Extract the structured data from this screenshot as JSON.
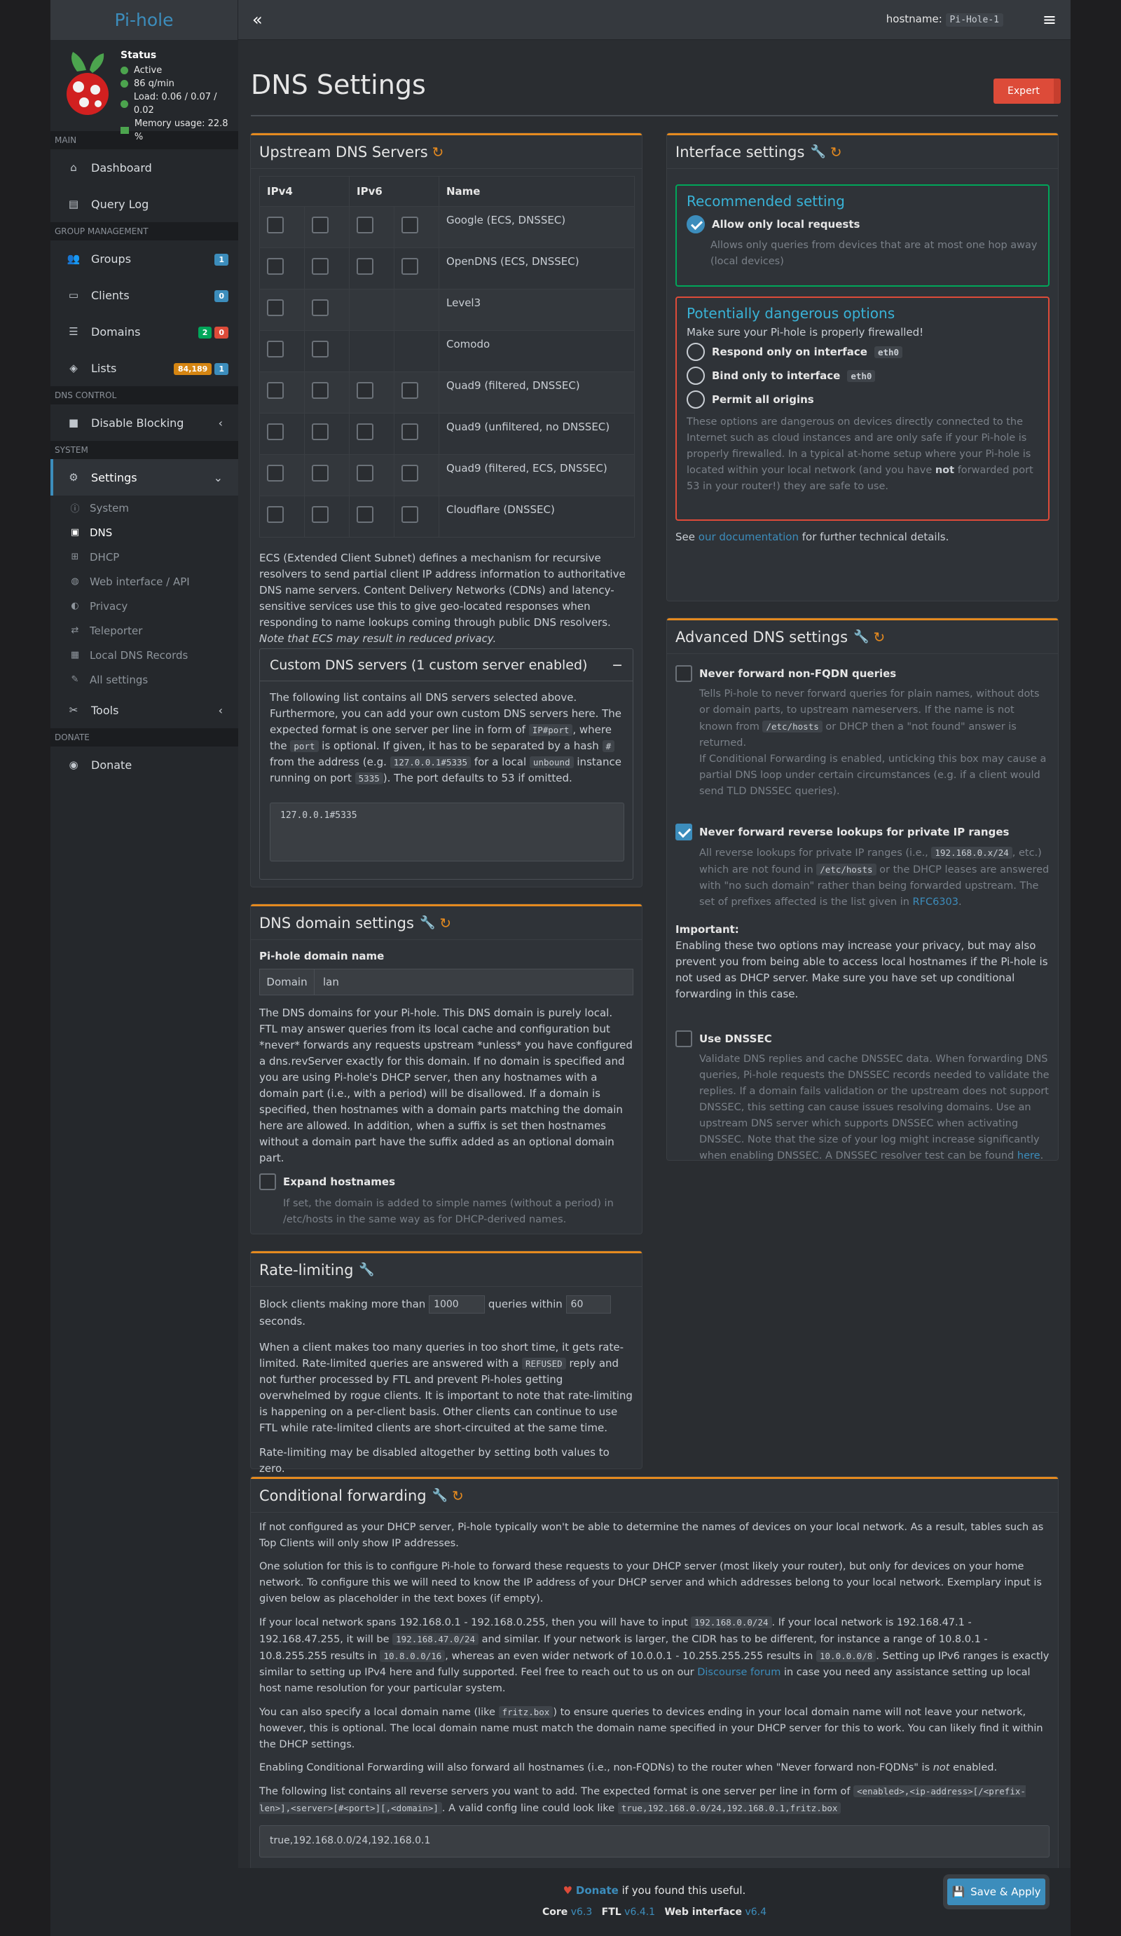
{
  "app": {
    "brand_pi": "Pi",
    "brand_rest": "-hole",
    "hostname_label": "hostname:",
    "hostname": "Pi-Hole-1",
    "collapse_icon": "«",
    "menu_icon": "≡"
  },
  "status": {
    "title": "Status",
    "active": "Active",
    "rate": "86 q/min",
    "load": "Load: 0.06 / 0.07 / 0.02",
    "memory": "Memory usage: 22.8 %"
  },
  "sidebar": {
    "sections": {
      "main": "MAIN",
      "group": "GROUP MANAGEMENT",
      "dnsctl": "DNS CONTROL",
      "system": "SYSTEM",
      "donate": "DONATE"
    },
    "dashboard": "Dashboard",
    "querylog": "Query Log",
    "groups": "Groups",
    "groups_badge": "1",
    "clients": "Clients",
    "clients_badge": "0",
    "domains": "Domains",
    "domains_b1": "2",
    "domains_b2": "0",
    "lists": "Lists",
    "lists_b1": "84,189",
    "lists_b2": "1",
    "disable": "Disable Blocking",
    "settings": "Settings",
    "sub": {
      "system": "System",
      "dns": "DNS",
      "dhcp": "DHCP",
      "web": "Web interface / API",
      "privacy": "Privacy",
      "teleporter": "Teleporter",
      "localdns": "Local DNS Records",
      "all": "All settings"
    },
    "tools": "Tools",
    "donate": "Donate"
  },
  "page": {
    "title": "DNS Settings",
    "expert": "Expert"
  },
  "upstream": {
    "title": "Upstream DNS Servers",
    "h_ipv4": "IPv4",
    "h_ipv6": "IPv6",
    "h_name": "Name",
    "rows": [
      {
        "name": "Google (ECS, DNSSEC)"
      },
      {
        "name": "OpenDNS (ECS, DNSSEC)"
      },
      {
        "name": "Level3"
      },
      {
        "name": "Comodo"
      },
      {
        "name": "Quad9 (filtered, DNSSEC)"
      },
      {
        "name": "Quad9 (unfiltered, no DNSSEC)"
      },
      {
        "name": "Quad9 (filtered, ECS, DNSSEC)"
      },
      {
        "name": "Cloudflare (DNSSEC)"
      }
    ],
    "ecs_text": "ECS (Extended Client Subnet) defines a mechanism for recursive resolvers to send partial client IP address information to authoritative DNS name servers. Content Delivery Networks (CDNs) and latency-sensitive services use this to give geo-located responses when responding to name lookups coming through public DNS resolvers.",
    "ecs_note": "Note that ECS may result in reduced privacy.",
    "custom_title": "Custom DNS servers (1 custom server enabled)",
    "custom_minus": "−",
    "custom_p1": "The following list contains all DNS servers selected above. Furthermore, you can add your own custom DNS servers here. The expected format is one server per line in form of",
    "code_ipport": "IP#port",
    "custom_p2": ", where the",
    "code_port": "port",
    "custom_p3": "is optional. If given, it has to be separated by a hash",
    "code_hash": "#",
    "custom_p4": "from the address (e.g.",
    "code_ex": "127.0.0.1#5335",
    "custom_p5": "for a local",
    "code_unbound": "unbound",
    "custom_p6": "instance running on port",
    "code_5335": "5335",
    "custom_p7": "). The port defaults to 53 if omitted.",
    "custom_value": "127.0.0.1#5335"
  },
  "domain": {
    "title": "DNS domain settings",
    "label": "Pi-hole domain name",
    "addon": "Domain",
    "value": "lan",
    "desc": "The DNS domains for your Pi-hole. This DNS domain is purely local. FTL may answer queries from its local cache and configuration but *never* forwards any requests upstream *unless* you have configured a dns.revServer exactly for this domain. If no domain is specified and you are using Pi-hole's DHCP server, then any hostnames with a domain part (i.e., with a period) will be disallowed. If a domain is specified, then hostnames with a domain parts matching the domain here are allowed. In addition, when a suffix is set then hostnames without a domain part have the suffix added as an optional domain part.",
    "expand": "Expand hostnames",
    "expand_hint": "If set, the domain is added to simple names (without a period) in /etc/hosts in the same way as for DHCP-derived names."
  },
  "rate": {
    "title": "Rate-limiting",
    "p1": "Block clients making more than",
    "count": "1000",
    "p2": "queries within",
    "secs": "60",
    "p3": "seconds.",
    "desc1a": "When a client makes too many queries in too short time, it gets rate-limited. Rate-limited queries are answered with a",
    "refused": "REFUSED",
    "desc1b": "reply and not further processed by FTL and prevent Pi-holes getting overwhelmed by rogue clients. It is important to note that rate-limiting is happening on a per-client basis. Other clients can continue to use FTL while rate-limited clients are short-circuited at the same time.",
    "desc2": "Rate-limiting may be disabled altogether by setting both values to zero."
  },
  "iface": {
    "title": "Interface settings",
    "rec_title": "Recommended setting",
    "local": "Allow only local requests",
    "local_hint": "Allows only queries from devices that are at most one hop away (local devices)",
    "danger_title": "Potentially dangerous options",
    "danger_sub": "Make sure your Pi-hole is properly firewalled!",
    "only_iface": "Respond only on interface",
    "eth0": "eth0",
    "bind": "Bind only to interface",
    "all": "Permit all origins",
    "danger_hint_a": "These options are dangerous on devices directly connected to the Internet such as cloud instances and are only safe if your Pi-hole is properly firewalled. In a typical at-home setup where your Pi-hole is located within your local network (and you have",
    "danger_not": "not",
    "danger_hint_b": "forwarded port 53 in your router!) they are safe to use.",
    "see": "See",
    "doc": "our documentation",
    "see2": "for further technical details."
  },
  "adv": {
    "title": "Advanced DNS settings",
    "fqdn": "Never forward non-FQDN queries",
    "fqdn_h1": "Tells Pi-hole to never forward queries for plain names, without dots or domain parts, to upstream nameservers. If the name is not known from",
    "etchosts": "/etc/hosts",
    "fqdn_h2": "or DHCP then a \"not found\" answer is returned.",
    "fqdn_h3": "If Conditional Forwarding is enabled, unticking this box may cause a partial DNS loop under certain circumstances (e.g. if a client would send TLD DNSSEC queries).",
    "rev": "Never forward reverse lookups for private IP ranges",
    "rev_h1": "All reverse lookups for private IP ranges (i.e.,",
    "rev_code": "192.168.0.x/24",
    "rev_h2": ", etc.) which are not found in",
    "rev_h3": "or the DHCP leases are answered with \"no such domain\" rather than being forwarded upstream. The set of prefixes affected is the list given in",
    "rfc": "RFC6303",
    "rev_h4": ".",
    "imp_title": "Important:",
    "imp": "Enabling these two options may increase your privacy, but may also prevent you from being able to access local hostnames if the Pi-hole is not used as DHCP server. Make sure you have set up conditional forwarding in this case.",
    "dnssec": "Use DNSSEC",
    "dnssec_h": "Validate DNS replies and cache DNSSEC data. When forwarding DNS queries, Pi-hole requests the DNSSEC records needed to validate the replies. If a domain fails validation or the upstream does not support DNSSEC, this setting can cause issues resolving domains. Use an upstream DNS server which supports DNSSEC when activating DNSSEC. Note that the size of your log might increase significantly when enabling DNSSEC. A DNSSEC resolver test can be found",
    "here": "here",
    "dot": "."
  },
  "cond": {
    "title": "Conditional forwarding",
    "p1": "If not configured as your DHCP server, Pi-hole typically won't be able to determine the names of devices on your local network. As a result, tables such as Top Clients will only show IP addresses.",
    "p2": "One solution for this is to configure Pi-hole to forward these requests to your DHCP server (most likely your router), but only for devices on your home network. To configure this we will need to know the IP address of your DHCP server and which addresses belong to your local network. Exemplary input is given below as placeholder in the text boxes (if empty).",
    "p3a": "If your local network spans 192.168.0.1 - 192.168.0.255, then you will have to input",
    "c1": "192.168.0.0/24",
    "p3b": ". If your local network is 192.168.47.1 - 192.168.47.255, it will be",
    "c2": "192.168.47.0/24",
    "p3c": "and similar. If your network is larger, the CIDR has to be different, for instance a range of 10.8.0.1 - 10.8.255.255 results in",
    "c3": "10.8.0.0/16",
    "p3d": ", whereas an even wider network of 10.0.0.1 - 10.255.255.255 results in",
    "c4": "10.0.0.0/8",
    "p3e": ". Setting up IPv6 ranges is exactly similar to setting up IPv4 here and fully supported. Feel free to reach out to us on our",
    "forum": "Discourse forum",
    "p3f": "in case you need any assistance setting up local host name resolution for your particular system.",
    "p4a": "You can also specify a local domain name (like",
    "c5": "fritz.box",
    "p4b": ") to ensure queries to devices ending in your local domain name will not leave your network, however, this is optional. The local domain name must match the domain name specified in your DHCP server for this to work. You can likely find it within the DHCP settings.",
    "p5a": "Enabling Conditional Forwarding will also forward all hostnames (i.e., non-FQDNs) to the router when \"Never forward non-FQDNs\" is",
    "p5not": "not",
    "p5b": "enabled.",
    "p6a": "The following list contains all reverse servers you want to add. The expected format is one server per line in form of",
    "c6": "<enabled>,<ip-address>[/<prefix-len>],<server>[#<port>][,<domain>]",
    "p6b": ". A valid config line could look like",
    "c7": "true,192.168.0.0/24,192.168.0.1,fritz.box",
    "value": "true,192.168.0.0/24,192.168.0.1"
  },
  "footer": {
    "donate": "Donate",
    "donate_rest": "if you found this useful.",
    "core": "Core",
    "core_v": "v6.3",
    "ftl": "FTL",
    "ftl_v": "v6.4.1",
    "web": "Web interface",
    "web_v": "v6.4",
    "save": "Save & Apply"
  }
}
